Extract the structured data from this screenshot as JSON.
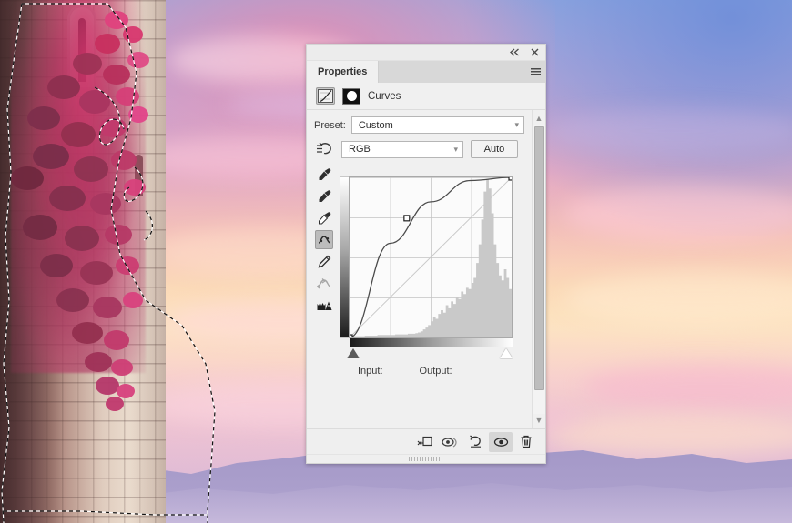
{
  "app": {
    "panel_title": "Properties",
    "adjustment_name": "Curves"
  },
  "titlebar": {
    "collapse_label": "«",
    "close_label": "×",
    "menu_name": "panel-menu"
  },
  "controls": {
    "preset_label": "Preset:",
    "preset_value": "Custom",
    "channel_value": "RGB",
    "auto_label": "Auto",
    "input_label": "Input:",
    "output_label": "Output:",
    "input_value": "",
    "output_value": "",
    "chevron": "˅"
  },
  "tools": [
    {
      "name": "on-image-adjust-icon",
      "title": "On-image adjustment tool",
      "selected": false
    },
    {
      "name": "black-point-eyedropper-icon",
      "title": "Sample in image to set black point",
      "selected": false
    },
    {
      "name": "gray-point-eyedropper-icon",
      "title": "Sample in image to set gray point",
      "selected": false
    },
    {
      "name": "white-point-eyedropper-icon",
      "title": "Sample in image to set white point",
      "selected": false
    },
    {
      "name": "curve-point-tool-icon",
      "title": "Edit points to modify the curve",
      "selected": true
    },
    {
      "name": "pencil-draw-curve-icon",
      "title": "Draw to modify the curve",
      "selected": false
    },
    {
      "name": "smooth-curve-icon",
      "title": "Smooth the curve values",
      "selected": false
    },
    {
      "name": "clipping-warning-icon",
      "title": "Show clipping for black/white points",
      "selected": false
    }
  ],
  "footer_buttons": [
    {
      "name": "clip-to-layer-button",
      "label": "Clip to layer",
      "active": false
    },
    {
      "name": "toggle-previous-state-button",
      "label": "View previous state",
      "active": false
    },
    {
      "name": "reset-adjustment-button",
      "label": "Reset to default",
      "active": false
    },
    {
      "name": "toggle-visibility-button",
      "label": "Toggle layer visibility",
      "active": true
    },
    {
      "name": "delete-adjustment-button",
      "label": "Delete adjustment layer",
      "active": false
    }
  ],
  "chart_data": {
    "type": "line",
    "title": "Curves (RGB)",
    "xlabel": "Input",
    "ylabel": "Output",
    "xlim": [
      0,
      255
    ],
    "ylim": [
      0,
      255
    ],
    "grid": true,
    "series": [
      {
        "name": "tone-curve",
        "points": [
          {
            "input": 0,
            "output": 0
          },
          {
            "input": 64,
            "output": 150
          },
          {
            "input": 128,
            "output": 216
          },
          {
            "input": 190,
            "output": 250
          },
          {
            "input": 255,
            "output": 255
          }
        ],
        "control_points": [
          {
            "input": 0,
            "output": 0
          },
          {
            "input": 90,
            "output": 190
          },
          {
            "input": 255,
            "output": 255
          }
        ]
      },
      {
        "name": "identity-baseline",
        "points": [
          {
            "input": 0,
            "output": 0
          },
          {
            "input": 255,
            "output": 255
          }
        ]
      }
    ],
    "histogram": {
      "bins": 64,
      "values": [
        2,
        2,
        2,
        2,
        2,
        2,
        3,
        3,
        3,
        3,
        3,
        4,
        4,
        4,
        4,
        4,
        4,
        4,
        5,
        5,
        5,
        5,
        5,
        6,
        6,
        6,
        7,
        8,
        10,
        13,
        16,
        20,
        26,
        33,
        30,
        38,
        44,
        40,
        52,
        47,
        58,
        54,
        66,
        62,
        74,
        70,
        80,
        78,
        88,
        96,
        120,
        150,
        190,
        235,
        255,
        240,
        200,
        150,
        120,
        100,
        92,
        110,
        96,
        78
      ]
    },
    "black_point_input": 0,
    "white_point_input": 255
  }
}
